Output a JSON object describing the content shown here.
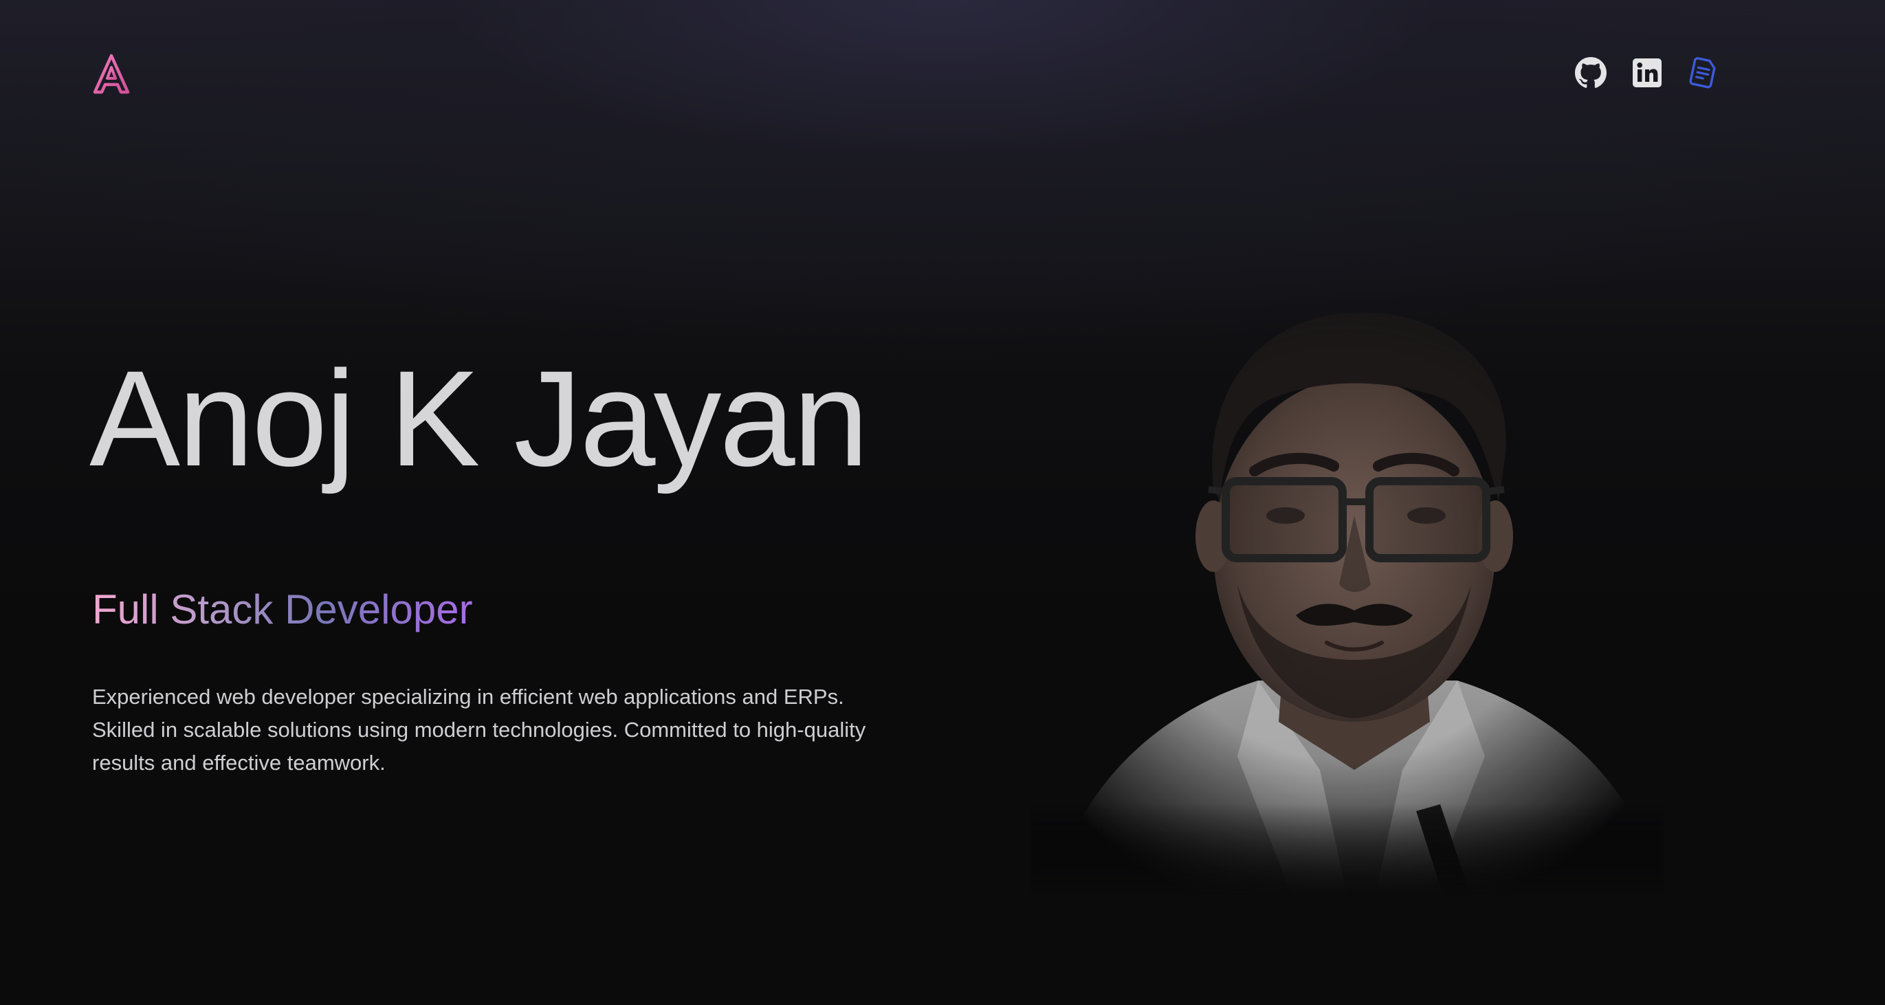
{
  "header": {
    "logo_icon": "gradient-letter-a-logo",
    "social_links": [
      {
        "icon": "github-icon",
        "label": "GitHub"
      },
      {
        "icon": "linkedin-icon",
        "label": "LinkedIn"
      },
      {
        "icon": "resume-document-icon",
        "label": "Resume"
      }
    ]
  },
  "hero": {
    "name": "Anoj K Jayan",
    "role": "Full Stack Developer",
    "description": "Experienced web developer specializing in efficient web applications and ERPs. Skilled in scalable solutions using modern technologies. Committed to high-quality results and effective teamwork."
  },
  "portrait": {
    "icon": "profile-photo"
  },
  "colors": {
    "background": "#0b0b0c",
    "name_text": "#d6d6d8",
    "logo_pink": "#e661a8",
    "resume_blue": "#3b5bdb",
    "role_gradient": [
      "#f2a6cf",
      "#7a78b8",
      "#a86ce6"
    ]
  }
}
